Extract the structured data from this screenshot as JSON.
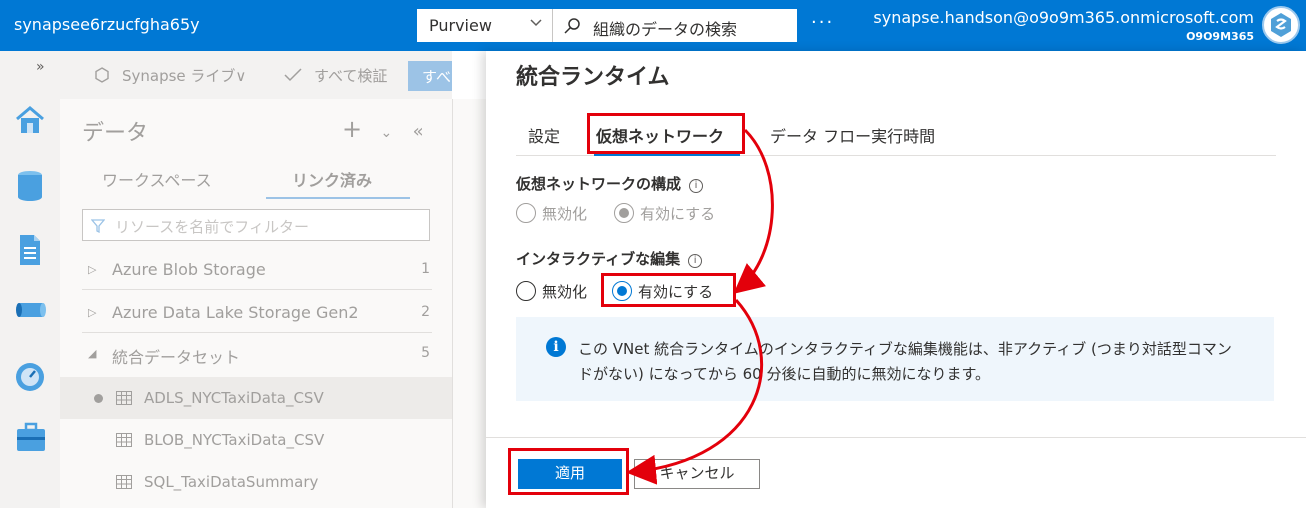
{
  "topbar": {
    "workspace_name": "synapsee6rzucfgha65y",
    "scope_value": "Purview",
    "search_placeholder": "組織のデータの検索",
    "more_label": "···",
    "user_email": "synapse.handson@o9o9m365.onmicrosoft.com",
    "user_tenant": "O9O9M365"
  },
  "rail": {
    "expand_label": "»",
    "items": [
      "home-icon",
      "data-icon",
      "develop-icon",
      "integrate-icon",
      "monitor-icon",
      "manage-icon"
    ]
  },
  "toolbar": {
    "synapse_live": "Synapse ライブ∨",
    "verify_all": "すべて検証",
    "publish_all": "すべ"
  },
  "data_pane": {
    "title": "データ",
    "tabs": [
      "ワークスペース",
      "リンク済み"
    ],
    "filter_placeholder": "リソースを名前でフィルター",
    "tree": [
      {
        "label": "Azure Blob Storage",
        "count": "1"
      },
      {
        "label": "Azure Data Lake Storage Gen2",
        "count": "2"
      },
      {
        "label": "統合データセット",
        "count": "5"
      }
    ],
    "datasets": [
      "ADLS_NYCTaxiData_CSV",
      "BLOB_NYCTaxiData_CSV",
      "SQL_TaxiDataSummary"
    ]
  },
  "flyout": {
    "title": "統合ランタイム",
    "tabs": [
      "設定",
      "仮想ネットワーク",
      "データ フロー実行時間"
    ],
    "vnet_section": {
      "label": "仮想ネットワークの構成",
      "options": [
        "無効化",
        "有効にする"
      ],
      "selected": "有効にする"
    },
    "interactive_section": {
      "label": "インタラクティブな編集",
      "options": [
        "無効化",
        "有効にする"
      ],
      "selected": "有効にする"
    },
    "info_text": "この VNet 統合ランタイムのインタラクティブな編集機能は、非アクティブ (つまり対話型コマンドがない) になってから 60 分後に自動的に無効になります。",
    "apply_label": "適用",
    "cancel_label": "キャンセル"
  },
  "colors": {
    "accent": "#0078d4",
    "highlight": "#e3000b"
  }
}
